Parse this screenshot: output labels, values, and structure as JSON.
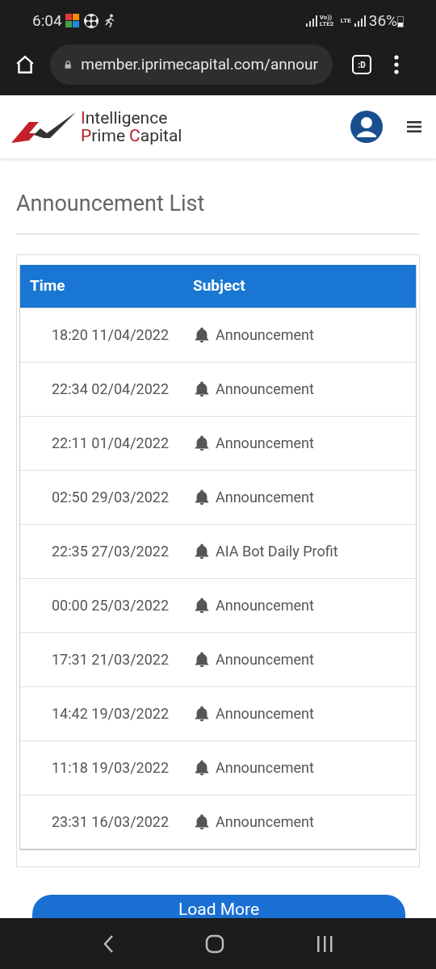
{
  "status_bar": {
    "time": "6:04",
    "network_1": "Vo)) LTE2",
    "network_2": "LTE",
    "battery": "36%"
  },
  "browser": {
    "url": "member.iprimecapital.com/annour",
    "tab_badge": ":D"
  },
  "site_header": {
    "logo_line_1": "Intelligence",
    "logo_line_2": "Prime Capital"
  },
  "page_title": "Announcement List",
  "table": {
    "columns": [
      "Time",
      "Subject"
    ],
    "rows": [
      {
        "time": "18:20 11/04/2022",
        "subject": "Announcement"
      },
      {
        "time": "22:34 02/04/2022",
        "subject": "Announcement"
      },
      {
        "time": "22:11 01/04/2022",
        "subject": "Announcement"
      },
      {
        "time": "02:50 29/03/2022",
        "subject": "Announcement"
      },
      {
        "time": "22:35 27/03/2022",
        "subject": "AIA Bot Daily Profit"
      },
      {
        "time": "00:00 25/03/2022",
        "subject": "Announcement"
      },
      {
        "time": "17:31 21/03/2022",
        "subject": "Announcement"
      },
      {
        "time": "14:42 19/03/2022",
        "subject": "Announcement"
      },
      {
        "time": "11:18 19/03/2022",
        "subject": "Announcement"
      },
      {
        "time": "23:31 16/03/2022",
        "subject": "Announcement"
      }
    ]
  },
  "load_more_button": "Load More"
}
